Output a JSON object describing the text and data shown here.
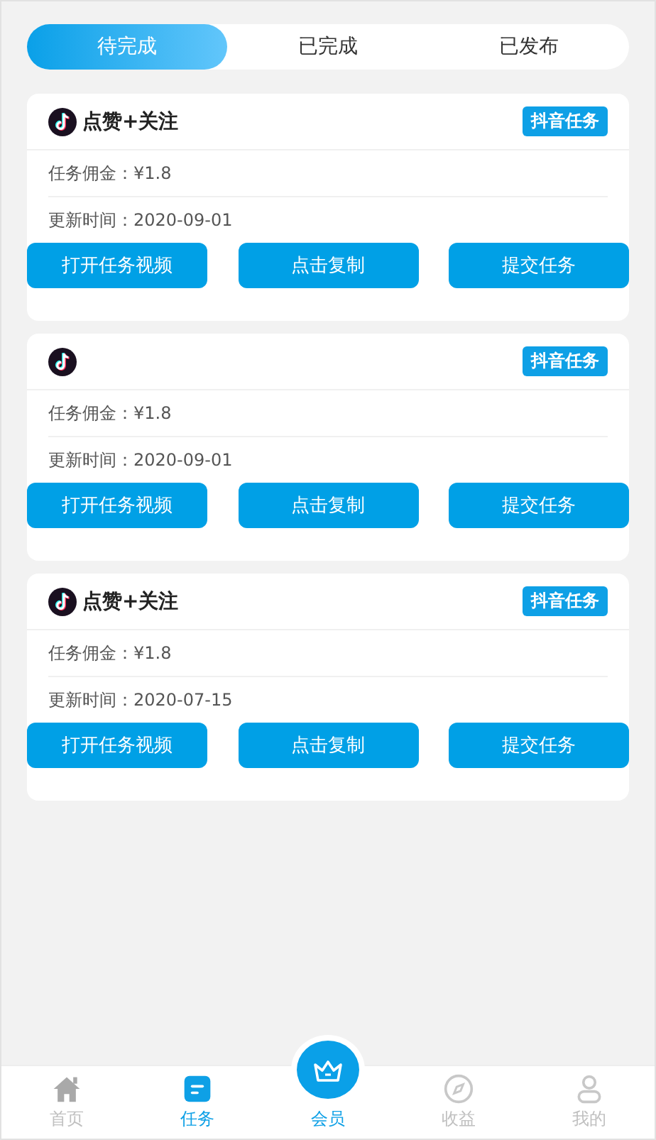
{
  "tabs": [
    {
      "label": "待完成",
      "selected": true
    },
    {
      "label": "已完成",
      "selected": false
    },
    {
      "label": "已发布",
      "selected": false
    }
  ],
  "tasks": [
    {
      "title": "点赞+关注",
      "tag": "抖音任务",
      "commission": "任务佣金：¥1.8",
      "updated": "更新时间：2020-09-01",
      "buttons": [
        "打开任务视频",
        "点击复制",
        "提交任务"
      ]
    },
    {
      "tag": "抖音任务",
      "commission": "任务佣金：¥1.8",
      "updated": "更新时间：2020-09-01",
      "buttons": [
        "打开任务视频",
        "点击复制",
        "提交任务"
      ]
    },
    {
      "title": "点赞+关注",
      "tag": "抖音任务",
      "commission": "任务佣金：¥1.8",
      "updated": "更新时间：2020-07-15",
      "buttons": [
        "打开任务视频",
        "点击复制",
        "提交任务"
      ]
    }
  ],
  "nav": [
    {
      "kind": "home",
      "label": "首页",
      "selected": false
    },
    {
      "kind": "task",
      "label": "任务",
      "selected": true
    },
    {
      "kind": "vip",
      "label": "会员"
    },
    {
      "kind": "earn",
      "label": "收益",
      "selected": false
    },
    {
      "kind": "me",
      "label": "我的",
      "selected": false
    }
  ]
}
